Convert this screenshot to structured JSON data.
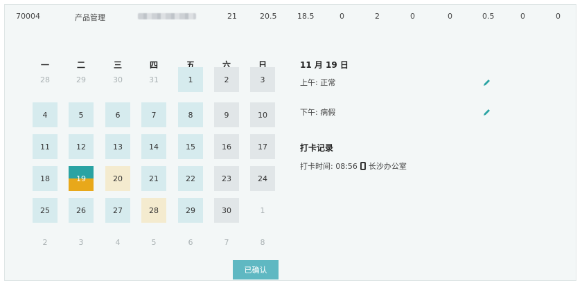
{
  "summary_row": {
    "employee_id": "70004",
    "department": "产品管理",
    "values": [
      "21",
      "20.5",
      "18.5",
      "0",
      "2",
      "0",
      "0",
      "0.5",
      "0",
      "0"
    ]
  },
  "calendar": {
    "weekdays": [
      "一",
      "二",
      "三",
      "四",
      "五",
      "六",
      "日"
    ],
    "weeks": [
      [
        {
          "d": "28",
          "t": "other"
        },
        {
          "d": "29",
          "t": "other"
        },
        {
          "d": "30",
          "t": "other"
        },
        {
          "d": "31",
          "t": "other"
        },
        {
          "d": "1",
          "t": "work"
        },
        {
          "d": "2",
          "t": "rest"
        },
        {
          "d": "3",
          "t": "rest"
        }
      ],
      [
        {
          "d": "4",
          "t": "work"
        },
        {
          "d": "5",
          "t": "work"
        },
        {
          "d": "6",
          "t": "work"
        },
        {
          "d": "7",
          "t": "work"
        },
        {
          "d": "8",
          "t": "work"
        },
        {
          "d": "9",
          "t": "rest"
        },
        {
          "d": "10",
          "t": "rest"
        }
      ],
      [
        {
          "d": "11",
          "t": "work"
        },
        {
          "d": "12",
          "t": "work"
        },
        {
          "d": "13",
          "t": "work"
        },
        {
          "d": "14",
          "t": "work"
        },
        {
          "d": "15",
          "t": "work"
        },
        {
          "d": "16",
          "t": "rest"
        },
        {
          "d": "17",
          "t": "rest"
        }
      ],
      [
        {
          "d": "18",
          "t": "work"
        },
        {
          "d": "19",
          "t": "today"
        },
        {
          "d": "20",
          "t": "leave"
        },
        {
          "d": "21",
          "t": "work"
        },
        {
          "d": "22",
          "t": "work"
        },
        {
          "d": "23",
          "t": "rest"
        },
        {
          "d": "24",
          "t": "rest"
        }
      ],
      [
        {
          "d": "25",
          "t": "work"
        },
        {
          "d": "26",
          "t": "work"
        },
        {
          "d": "27",
          "t": "work"
        },
        {
          "d": "28",
          "t": "leave"
        },
        {
          "d": "29",
          "t": "work"
        },
        {
          "d": "30",
          "t": "rest"
        },
        {
          "d": "1",
          "t": "other"
        }
      ],
      [
        {
          "d": "2",
          "t": "other"
        },
        {
          "d": "3",
          "t": "other"
        },
        {
          "d": "4",
          "t": "other"
        },
        {
          "d": "5",
          "t": "other"
        },
        {
          "d": "6",
          "t": "other"
        },
        {
          "d": "7",
          "t": "other"
        },
        {
          "d": "8",
          "t": "other"
        }
      ]
    ]
  },
  "detail": {
    "date": "11 月 19 日",
    "morning": "上午: 正常",
    "afternoon": "下午: 病假",
    "punch_title": "打卡记录",
    "punch_time": "打卡时间: 08:56",
    "punch_location": "长沙办公室"
  },
  "confirm_label": "已确认",
  "colors": {
    "work": "#d6ebee",
    "rest": "#e1e6e8",
    "leave": "#f4ebcf",
    "today_top": "#2aa3a3",
    "today_bottom": "#e8a81a",
    "button": "#5fb8c2",
    "edit": "#2aa3a3"
  }
}
